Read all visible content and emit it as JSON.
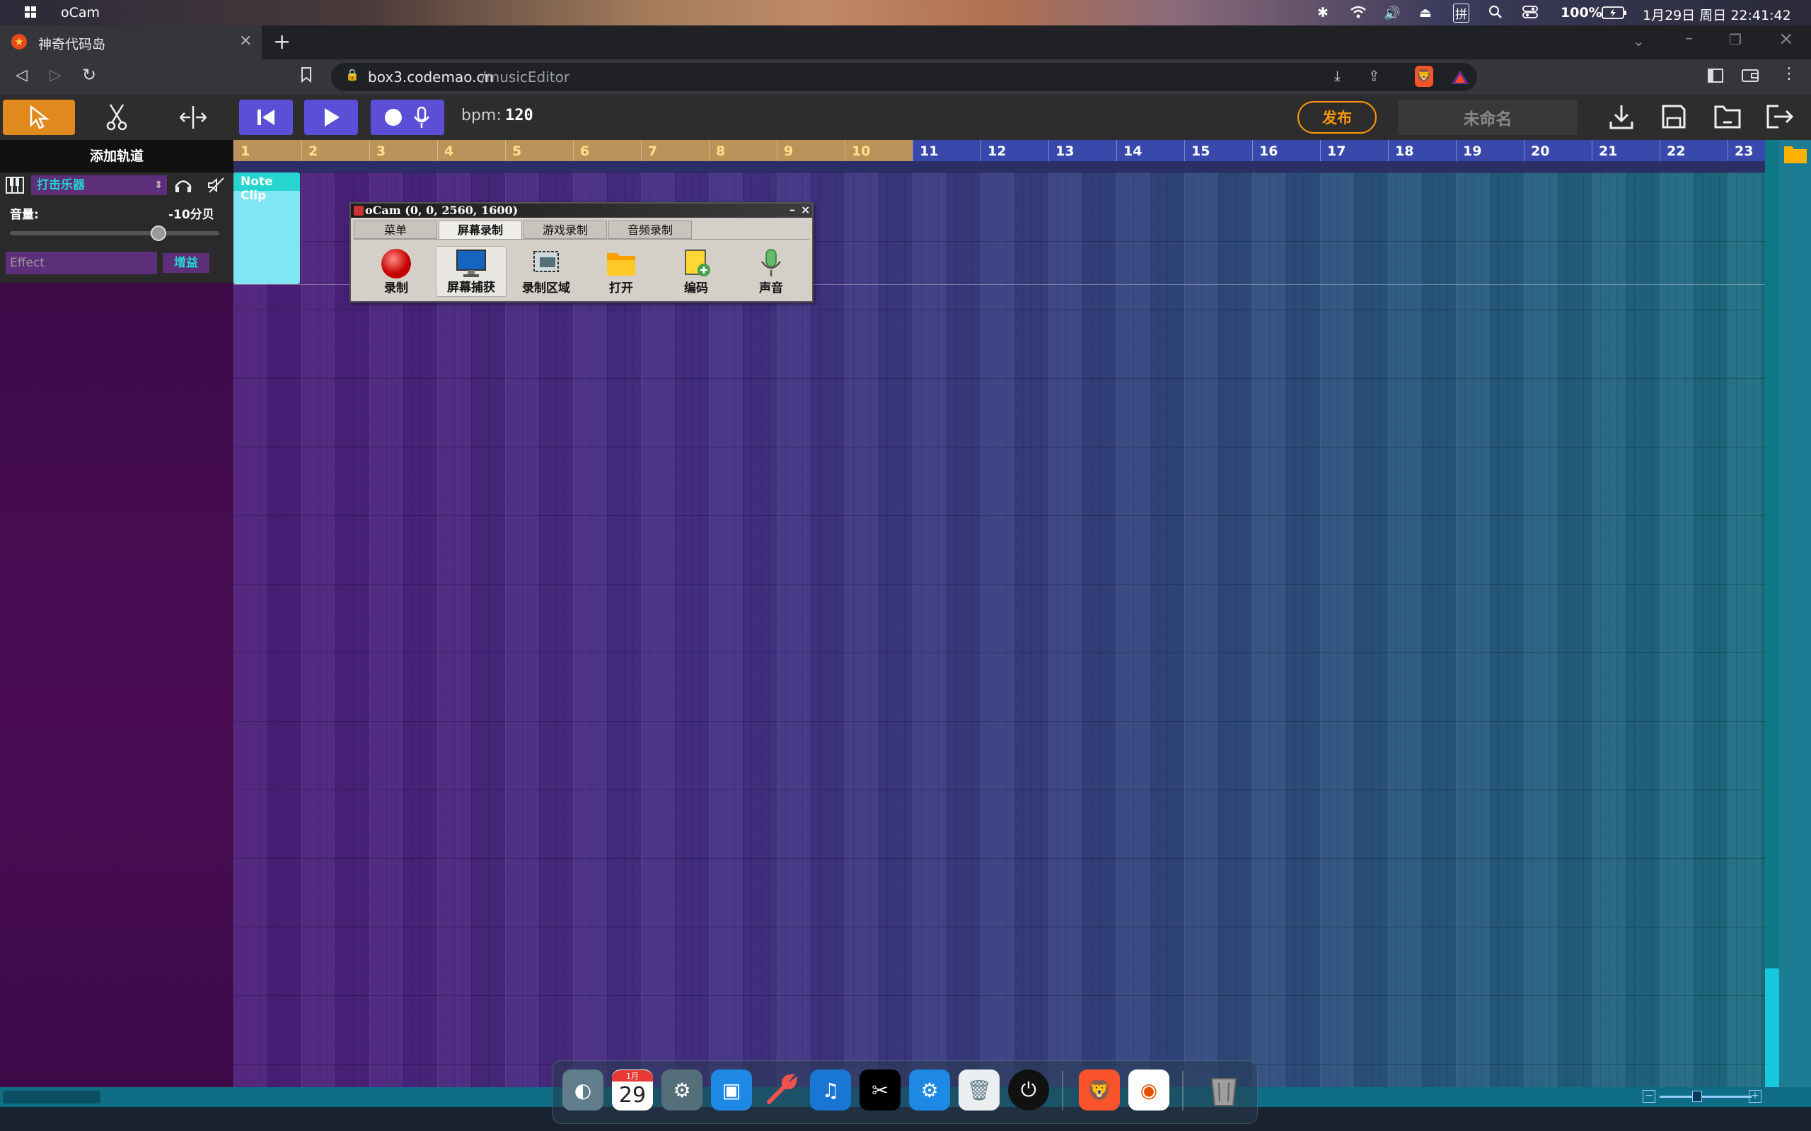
{
  "os_bar": {
    "app_name": "oCam",
    "battery": "100%",
    "datetime": "1月29日 周日 22:41:42",
    "ime": "拼"
  },
  "browser": {
    "tab_title": "神奇代码岛",
    "url_host": "box3.codemao.cn",
    "url_path": "/musicEditor"
  },
  "toolbar": {
    "bpm_label": "bpm:",
    "bpm_value": "120",
    "publish_label": "发布",
    "project_name": "未命名",
    "accent_color": "#ff9800"
  },
  "left_panel": {
    "add_track_label": "添加轨道",
    "instrument": "打击乐器",
    "volume_label": "音量:",
    "volume_value": "-10分贝",
    "volume_level": 0.71,
    "effect_placeholder": "Effect",
    "gain_button": "增益"
  },
  "timeline": {
    "bar_numbers": [
      "1",
      "2",
      "3",
      "4",
      "5",
      "6",
      "7",
      "8",
      "9",
      "10",
      "11",
      "12",
      "13",
      "14",
      "15",
      "16",
      "17",
      "18",
      "19",
      "20",
      "21",
      "22",
      "23"
    ],
    "clip_label": "Note Clip"
  },
  "ocam": {
    "title": "oCam (0, 0, 2560, 1600)",
    "tabs": [
      "菜单",
      "屏幕录制",
      "游戏录制",
      "音频录制"
    ],
    "active_tab": "屏幕录制",
    "tools": [
      "录制",
      "屏幕捕获",
      "录制区域",
      "打开",
      "编码",
      "声音"
    ]
  },
  "dock": {
    "calendar_month": "1月",
    "calendar_day": "29",
    "icons": [
      "launcher-icon",
      "calendar-icon",
      "control-center-icon",
      "file-manager-icon",
      "wrench-icon",
      "music-app-icon",
      "capcut-icon",
      "settings-icon",
      "trash-bin-icon",
      "power-icon",
      "brave-icon",
      "screen-recorder-icon",
      "recycle-bin-icon"
    ]
  }
}
